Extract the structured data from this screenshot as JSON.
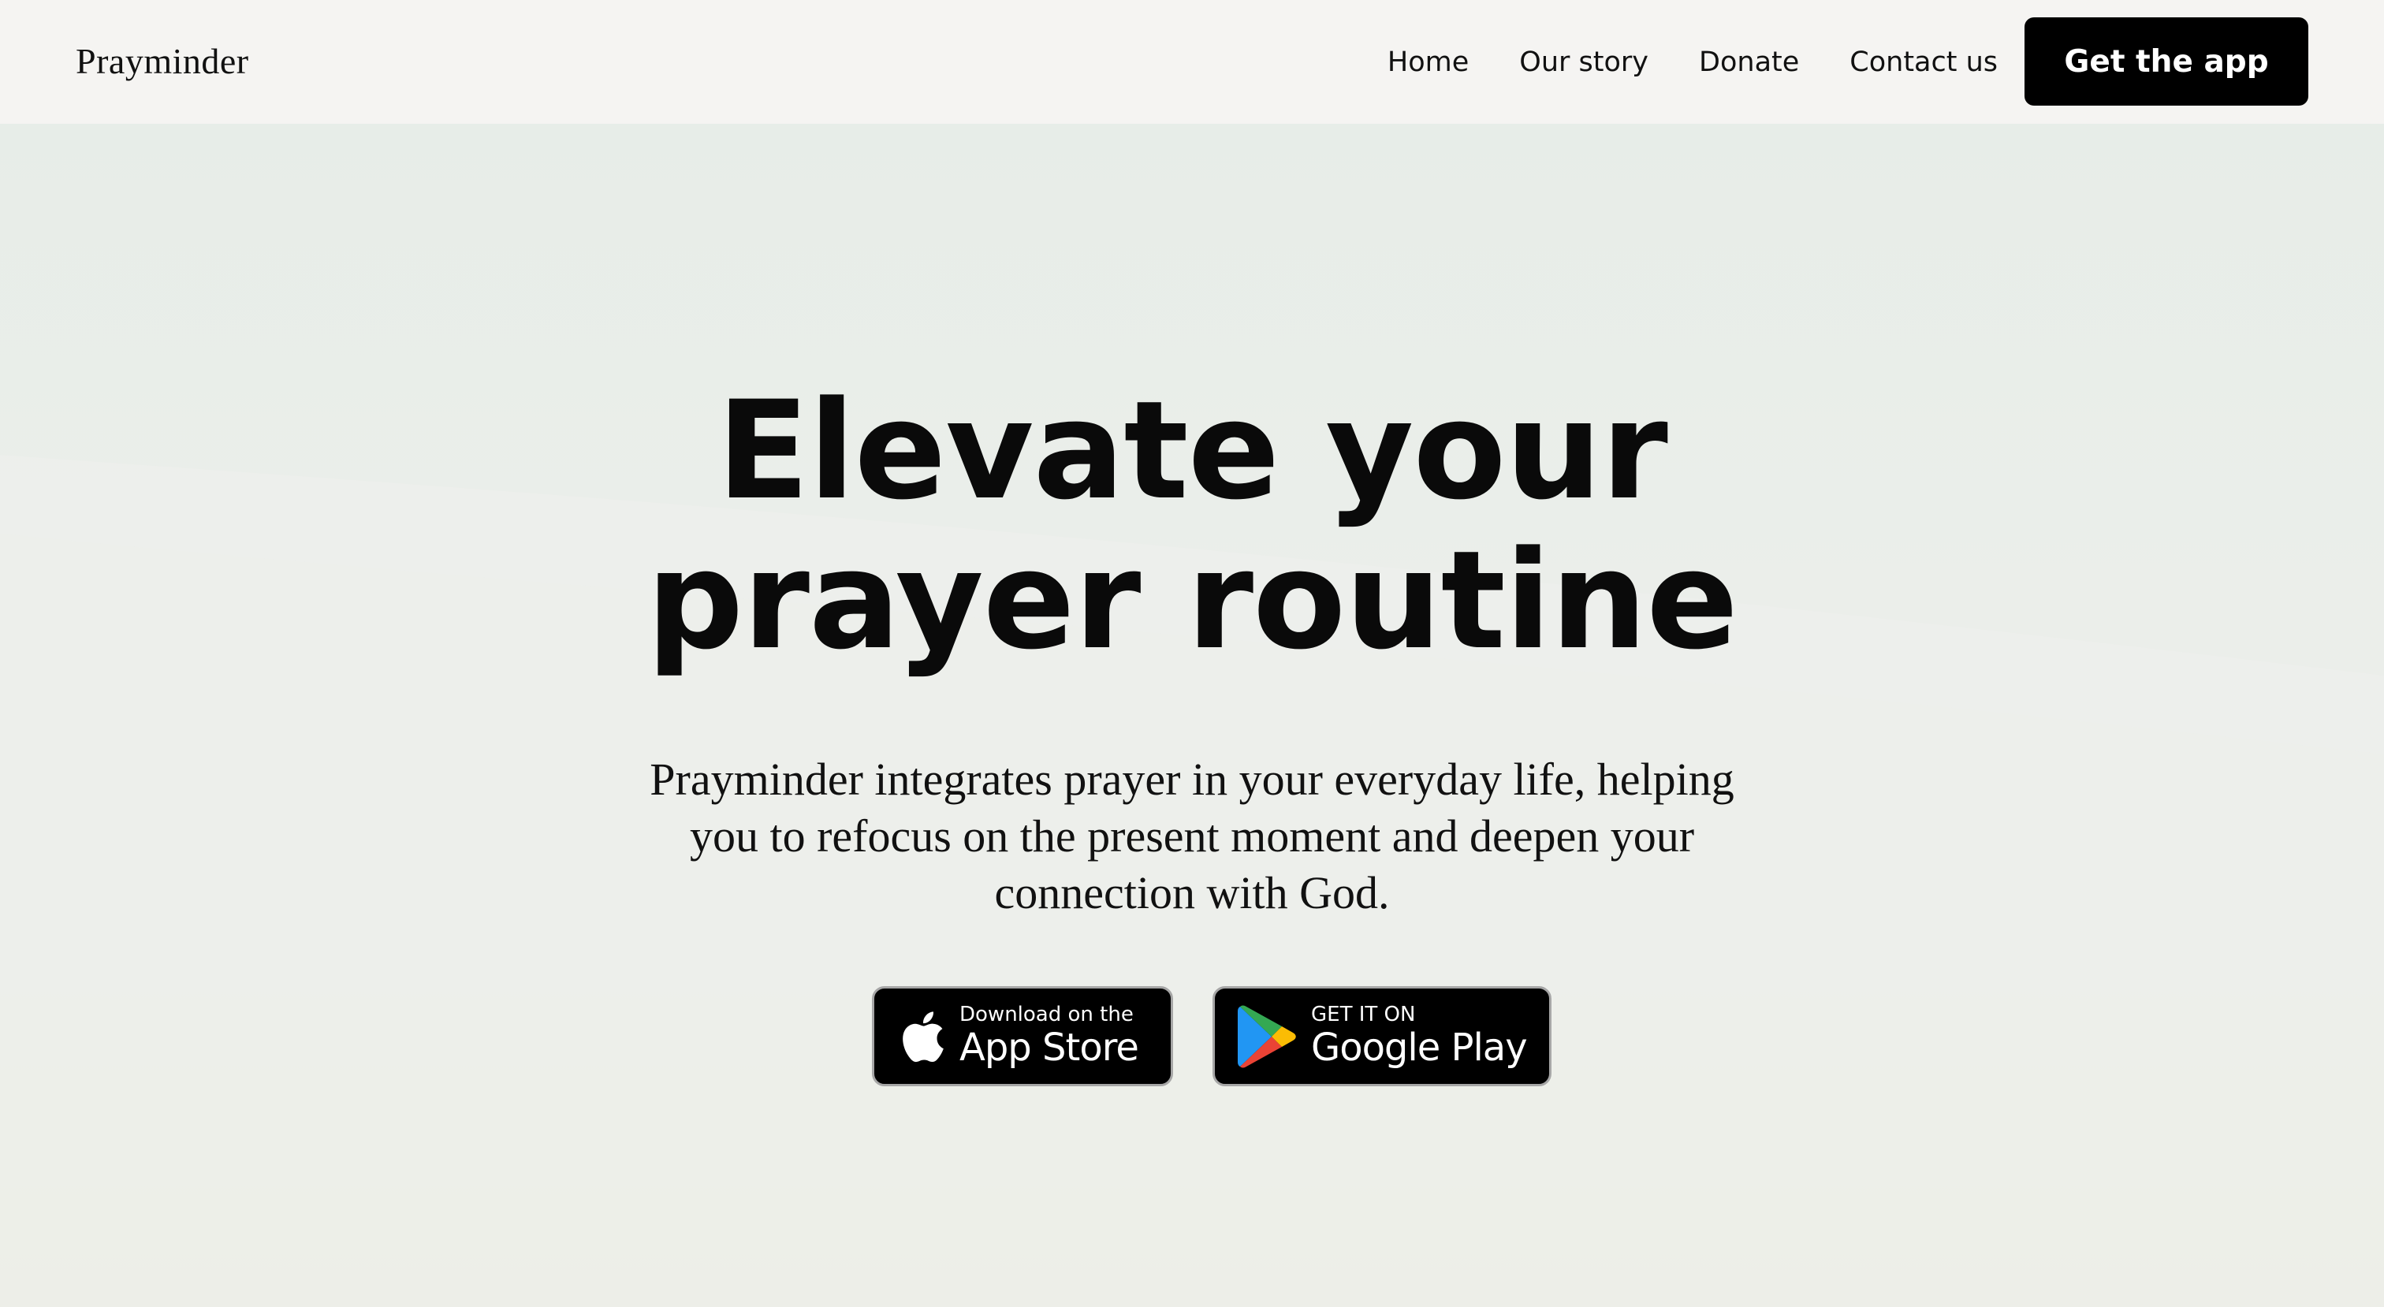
{
  "brand": {
    "name": "Prayminder"
  },
  "nav": {
    "items": [
      {
        "label": "Home"
      },
      {
        "label": "Our story"
      },
      {
        "label": "Donate"
      },
      {
        "label": "Contact us"
      }
    ],
    "cta_label": "Get the app"
  },
  "hero": {
    "title_line1": "Elevate your",
    "title_line2": "prayer routine",
    "subtitle": "Prayminder integrates prayer in your everyday life, helping you to refocus on the present moment and deepen your connection with God."
  },
  "badges": {
    "app_store": {
      "small": "Download on the",
      "big": "App Store",
      "icon": "apple-icon"
    },
    "google_play": {
      "small": "GET IT ON",
      "big": "Google Play",
      "icon": "google-play-icon"
    }
  },
  "colors": {
    "page_bg": "#f5f4f2",
    "hero_bg_top": "#e7ede8",
    "hero_bg_bottom": "#ece9de",
    "cta_bg": "#000000",
    "text": "#0a0a0a"
  }
}
